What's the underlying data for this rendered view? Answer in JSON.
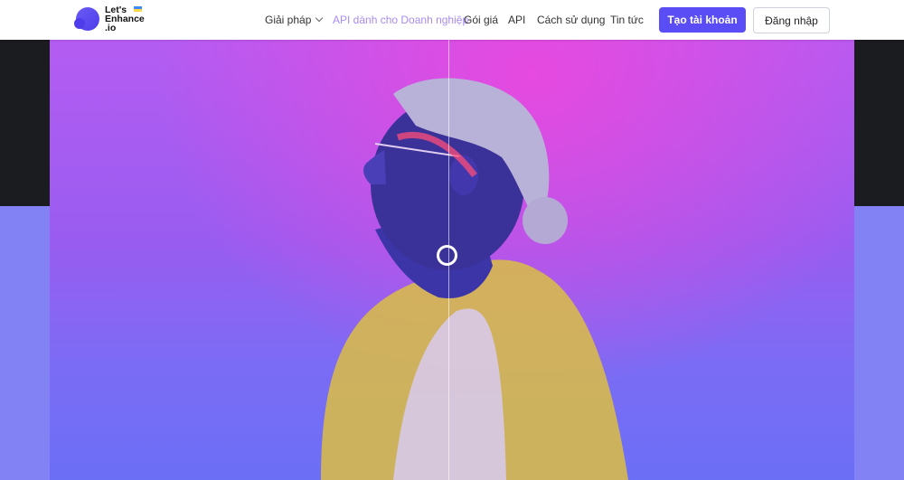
{
  "brand": {
    "name": "Let's\nEnhance\n.io"
  },
  "nav": {
    "items": [
      {
        "label": "Giải pháp",
        "has_dropdown": true
      },
      {
        "label": "API dành cho Doanh nghiệp",
        "active": true
      },
      {
        "label": "Gói giá"
      },
      {
        "label": "API"
      },
      {
        "label": "Cách sử dụng"
      },
      {
        "label": "Tin tức"
      }
    ],
    "primary_button": "Tạo tài khoản",
    "secondary_button": "Đăng nhập"
  },
  "colors": {
    "primary": "#5a4df5",
    "active_nav": "#a88bf7",
    "hero_background": "#8382f4",
    "side_dark": "#1b1c20"
  },
  "hero": {
    "image": "before-after comparison photo with slider handle",
    "icons": [
      "comparison-slider-handle-icon"
    ]
  }
}
